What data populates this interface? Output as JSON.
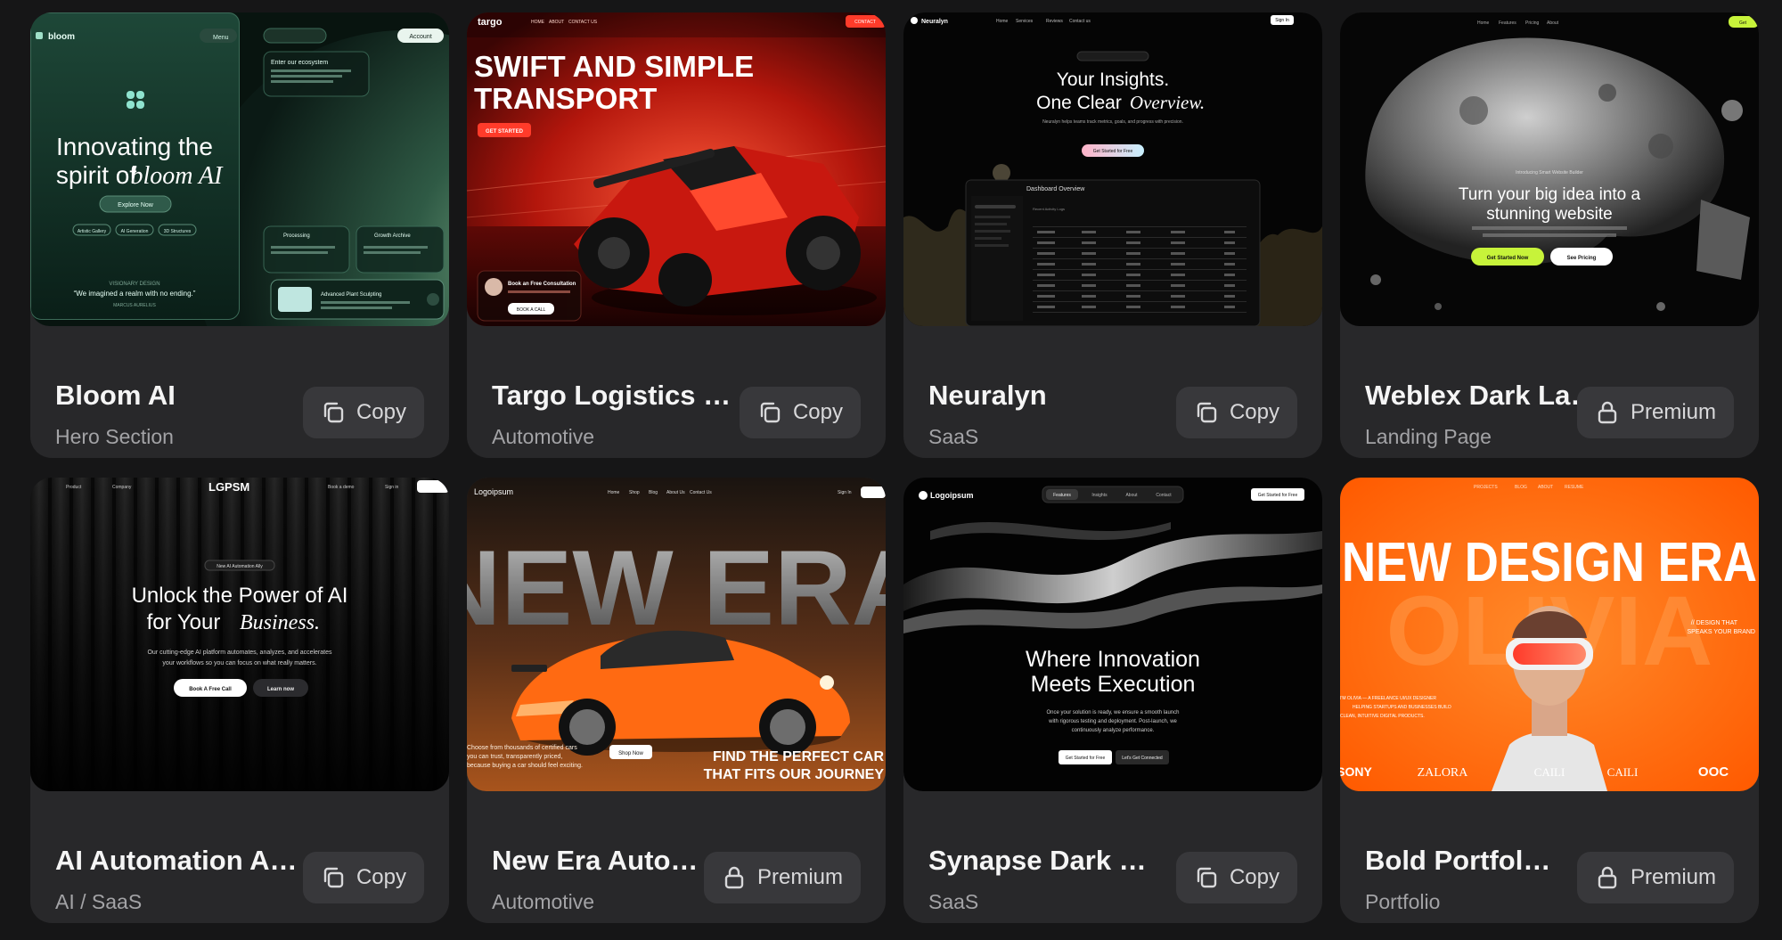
{
  "cards": [
    {
      "title": "Bloom AI",
      "category": "Hero Section",
      "action": "Copy",
      "action_icon": "copy-icon",
      "preview": {
        "brand": "bloom",
        "menu": "Menu",
        "account": "Account",
        "headline_1": "Innovating the",
        "headline_2": "spirit of",
        "headline_italic": "bloom AI",
        "cta": "Explore Now",
        "tags": [
          "Artistic Gallery",
          "AI Generation",
          "3D Structures"
        ],
        "panel_title": "Enter our ecosystem",
        "feature_1": "Processing",
        "feature_2": "Growth Archive",
        "feature_3": "Advanced Plant Sculpting",
        "quote_label": "VISIONARY DESIGN",
        "quote": "“We imagined a realm with no ending.”",
        "quote_author": "MARCUS AURELIUS"
      }
    },
    {
      "title": "Targo Logistics Hero",
      "category": "Automotive",
      "action": "Copy",
      "action_icon": "copy-icon",
      "preview": {
        "brand": "targo",
        "nav": [
          "HOME",
          "ABOUT",
          "CONTACT US"
        ],
        "nav_cta": "CONTACT",
        "headline_1": "SWIFT AND SIMPLE",
        "headline_2": "TRANSPORT",
        "cta": "GET STARTED",
        "consult_title": "Book an Free Consultation",
        "consult_btn": "BOOK A CALL"
      }
    },
    {
      "title": "Neuralyn",
      "category": "SaaS",
      "action": "Copy",
      "action_icon": "copy-icon",
      "preview": {
        "brand": "Neuralyn",
        "nav": [
          "Home",
          "Services",
          "Reviews",
          "Contact us"
        ],
        "nav_cta": "Sign In",
        "headline_1": "Your Insights.",
        "headline_2": "One Clear",
        "headline_italic": "Overview.",
        "body": "Neuralyn helps teams track metrics, goals, and progress with precision.",
        "cta": "Get Started for Free",
        "dashboard_title": "Dashboard Overview",
        "dashboard_sub": "Recent Activity Logs"
      }
    },
    {
      "title": "Weblex Dark Landing",
      "category": "Landing Page",
      "action": "Premium",
      "action_icon": "lock-icon",
      "preview": {
        "nav": [
          "Home",
          "Features",
          "Pricing",
          "About"
        ],
        "nav_cta": "Get",
        "eyebrow": "Introducing Smart Website Builder",
        "headline_1": "Turn your big idea into a",
        "headline_2": "stunning website",
        "cta_primary": "Get Started Now",
        "cta_secondary": "See Pricing"
      }
    },
    {
      "title": "AI Automation Agency",
      "category": "AI / SaaS",
      "action": "Copy",
      "action_icon": "copy-icon",
      "preview": {
        "brand": "LGPSM",
        "nav": [
          "Product",
          "Company"
        ],
        "nav_right": [
          "Book a demo",
          "Sign in"
        ],
        "badge": "New AI Automation Ally",
        "headline_1": "Unlock the Power of AI",
        "headline_2": "for Your",
        "headline_italic": "Business.",
        "body_1": "Our cutting-edge AI platform automates, analyzes, and accelerates",
        "body_2": "your workflows so you can focus on what really matters.",
        "cta_primary": "Book A Free Call",
        "cta_secondary": "Learn now"
      }
    },
    {
      "title": "New Era Automotive",
      "category": "Automotive",
      "action": "Premium",
      "action_icon": "lock-icon",
      "preview": {
        "brand": "Logoipsum",
        "nav": [
          "Home",
          "Shop",
          "Blog",
          "About Us",
          "Contact Us"
        ],
        "nav_right": "Sign In",
        "headline": "NEW ERA",
        "body_1": "Choose from thousands of certified cars",
        "body_2": "you can trust, transparently priced,",
        "body_3": "because buying a car should feel exciting.",
        "cta": "Shop Now",
        "tagline_1": "FIND THE PERFECT CAR",
        "tagline_2": "THAT FITS OUR JOURNEY"
      }
    },
    {
      "title": "Synapse Dark SaaS",
      "category": "SaaS",
      "action": "Copy",
      "action_icon": "copy-icon",
      "preview": {
        "brand": "Logoipsum",
        "nav": [
          "Features",
          "Insights",
          "About",
          "Contact"
        ],
        "nav_cta": "Get Started for Free",
        "headline_1": "Where Innovation",
        "headline_2": "Meets Execution",
        "body_1": "Once your solution is ready, we ensure a smooth launch",
        "body_2": "with rigorous testing and deployment. Post-launch, we",
        "body_3": "continuously analyze performance.",
        "cta_primary": "Get Started for Free",
        "cta_secondary": "Let's Get Connected"
      }
    },
    {
      "title": "Bold Portfolio Hero",
      "category": "Portfolio",
      "action": "Premium",
      "action_icon": "lock-icon",
      "preview": {
        "nav": [
          "PROJECTS",
          "BLOG",
          "ABOUT",
          "RESUME"
        ],
        "headline": "NEW DESIGN ERA",
        "background_word": "OLIVIA",
        "side_1": "// DESIGN THAT",
        "side_2": "SPEAKS YOUR BRAND",
        "intro_1": "I'M OLIVIA — A FREELANCE UI/UX DESIGNER",
        "intro_2": "HELPING STARTUPS AND BUSINESSES BUILD",
        "intro_3": "CLEAN, INTUITIVE DIGITAL PRODUCTS.",
        "logos": [
          "SONY",
          "ZALORA",
          "CAILI",
          "CAILI",
          "OOC"
        ]
      }
    }
  ],
  "colors": {
    "page_bg": "#161617",
    "card_bg": "#28282a",
    "button_bg": "#38383b",
    "title_text": "#f5f5f5",
    "subtitle_text": "#a3a3a6",
    "accent_lime": "#c7f33a",
    "accent_orange": "#ff6a1a"
  }
}
